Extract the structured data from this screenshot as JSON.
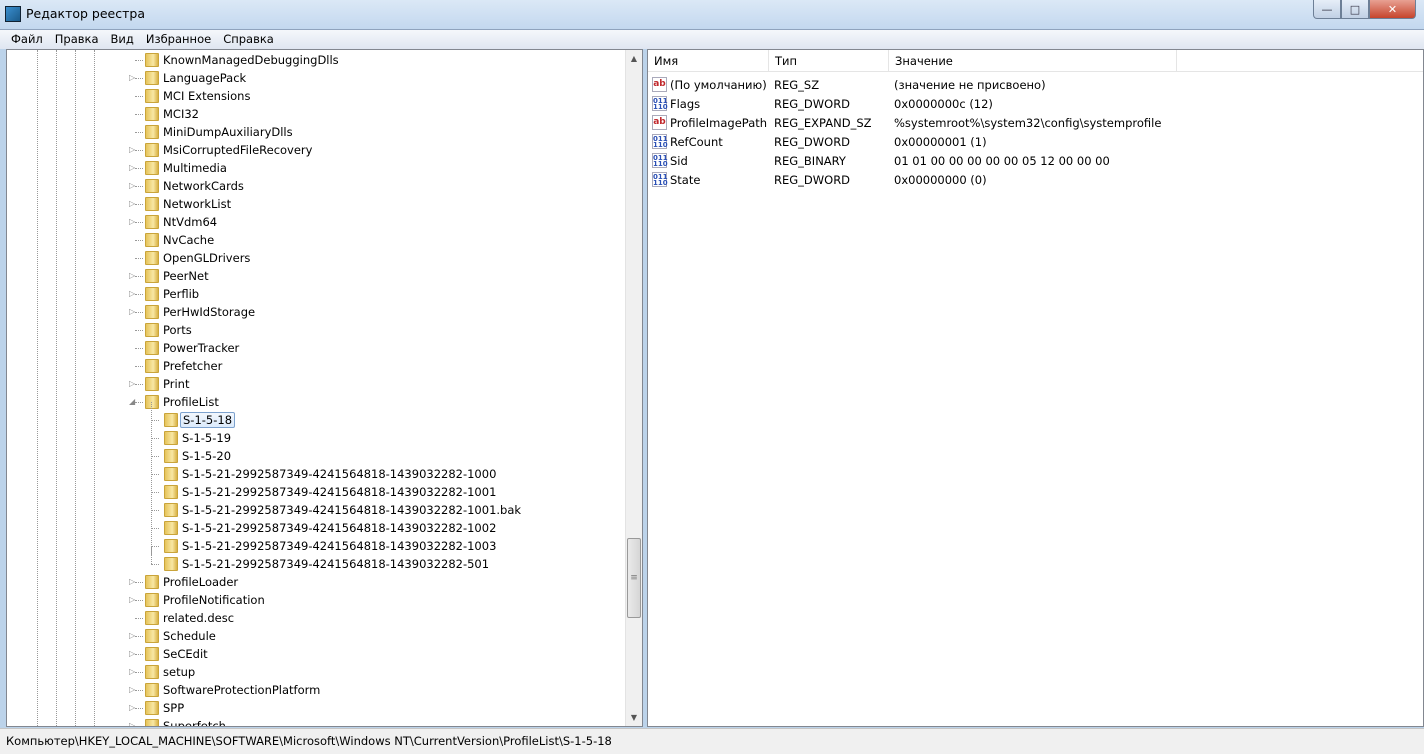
{
  "window": {
    "title": "Редактор реестра",
    "minimize": "—",
    "maximize": "□",
    "close": "✕"
  },
  "menu": [
    "Файл",
    "Правка",
    "Вид",
    "Избранное",
    "Справка"
  ],
  "tree": [
    {
      "label": "KnownManagedDebuggingDlls",
      "exp": ""
    },
    {
      "label": "LanguagePack",
      "exp": "▷"
    },
    {
      "label": "MCI Extensions",
      "exp": ""
    },
    {
      "label": "MCI32",
      "exp": ""
    },
    {
      "label": "MiniDumpAuxiliaryDlls",
      "exp": ""
    },
    {
      "label": "MsiCorruptedFileRecovery",
      "exp": "▷"
    },
    {
      "label": "Multimedia",
      "exp": "▷"
    },
    {
      "label": "NetworkCards",
      "exp": "▷"
    },
    {
      "label": "NetworkList",
      "exp": "▷"
    },
    {
      "label": "NtVdm64",
      "exp": "▷"
    },
    {
      "label": "NvCache",
      "exp": ""
    },
    {
      "label": "OpenGLDrivers",
      "exp": ""
    },
    {
      "label": "PeerNet",
      "exp": "▷"
    },
    {
      "label": "Perflib",
      "exp": "▷"
    },
    {
      "label": "PerHwIdStorage",
      "exp": "▷"
    },
    {
      "label": "Ports",
      "exp": ""
    },
    {
      "label": "PowerTracker",
      "exp": ""
    },
    {
      "label": "Prefetcher",
      "exp": ""
    },
    {
      "label": "Print",
      "exp": "▷"
    },
    {
      "label": "ProfileList",
      "exp": "◢"
    },
    {
      "label": "S-1-5-18",
      "child": true,
      "selected": true
    },
    {
      "label": "S-1-5-19",
      "child": true
    },
    {
      "label": "S-1-5-20",
      "child": true
    },
    {
      "label": "S-1-5-21-2992587349-4241564818-1439032282-1000",
      "child": true
    },
    {
      "label": "S-1-5-21-2992587349-4241564818-1439032282-1001",
      "child": true
    },
    {
      "label": "S-1-5-21-2992587349-4241564818-1439032282-1001.bak",
      "child": true
    },
    {
      "label": "S-1-5-21-2992587349-4241564818-1439032282-1002",
      "child": true
    },
    {
      "label": "S-1-5-21-2992587349-4241564818-1439032282-1003",
      "child": true
    },
    {
      "label": "S-1-5-21-2992587349-4241564818-1439032282-501",
      "child": true
    },
    {
      "label": "ProfileLoader",
      "exp": "▷"
    },
    {
      "label": "ProfileNotification",
      "exp": "▷"
    },
    {
      "label": "related.desc",
      "exp": ""
    },
    {
      "label": "Schedule",
      "exp": "▷"
    },
    {
      "label": "SeCEdit",
      "exp": "▷"
    },
    {
      "label": "setup",
      "exp": "▷"
    },
    {
      "label": "SoftwareProtectionPlatform",
      "exp": "▷"
    },
    {
      "label": "SPP",
      "exp": "▷"
    },
    {
      "label": "Superfetch",
      "exp": "▷"
    }
  ],
  "list": {
    "columns": [
      "Имя",
      "Тип",
      "Значение"
    ],
    "rows": [
      {
        "icon": "ab",
        "name": "(По умолчанию)",
        "type": "REG_SZ",
        "value": "(значение не присвоено)"
      },
      {
        "icon": "bin",
        "name": "Flags",
        "type": "REG_DWORD",
        "value": "0x0000000c (12)"
      },
      {
        "icon": "ab",
        "name": "ProfileImagePath",
        "type": "REG_EXPAND_SZ",
        "value": "%systemroot%\\system32\\config\\systemprofile"
      },
      {
        "icon": "bin",
        "name": "RefCount",
        "type": "REG_DWORD",
        "value": "0x00000001 (1)"
      },
      {
        "icon": "bin",
        "name": "Sid",
        "type": "REG_BINARY",
        "value": "01 01 00 00 00 00 00 05 12 00 00 00"
      },
      {
        "icon": "bin",
        "name": "State",
        "type": "REG_DWORD",
        "value": "0x00000000 (0)"
      }
    ]
  },
  "status": "Компьютер\\HKEY_LOCAL_MACHINE\\SOFTWARE\\Microsoft\\Windows NT\\CurrentVersion\\ProfileList\\S-1-5-18"
}
